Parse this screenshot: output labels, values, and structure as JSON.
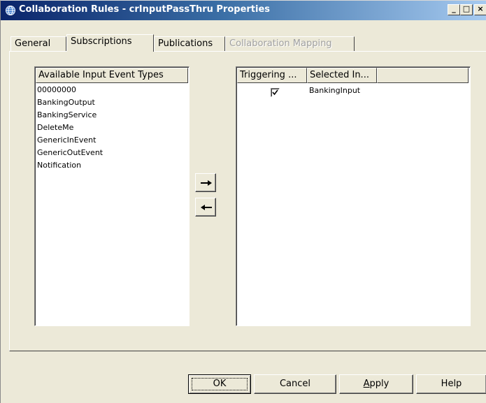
{
  "window": {
    "title": "Collaboration Rules - crInputPassThru Properties",
    "controls": {
      "minimize": "_",
      "maximize": "□",
      "close": "×"
    }
  },
  "tabs": [
    {
      "label": "General",
      "state": "normal"
    },
    {
      "label": "Subscriptions",
      "state": "active"
    },
    {
      "label": "Publications",
      "state": "normal"
    },
    {
      "label": "Collaboration Mapping",
      "state": "disabled"
    }
  ],
  "available": {
    "header": "Available Input Event Types",
    "items": [
      "00000000",
      "BankingOutput",
      "BankingService",
      "DeleteMe",
      "GenericInEvent",
      "GenericOutEvent",
      "Notification"
    ]
  },
  "selected": {
    "columns": [
      "Triggering ...",
      "Selected In..."
    ],
    "rows": [
      {
        "triggering": true,
        "name": "BankingInput"
      }
    ]
  },
  "arrows": {
    "add_icon": "arrow-right-icon",
    "remove_icon": "arrow-left-icon"
  },
  "buttons": {
    "ok": "OK",
    "cancel": "Cancel",
    "apply_mnemonic": "A",
    "apply_rest": "pply",
    "help": "Help"
  },
  "colors": {
    "titlebar_start": "#0a246a",
    "titlebar_end": "#a6caf0",
    "face": "#ece9d8"
  }
}
